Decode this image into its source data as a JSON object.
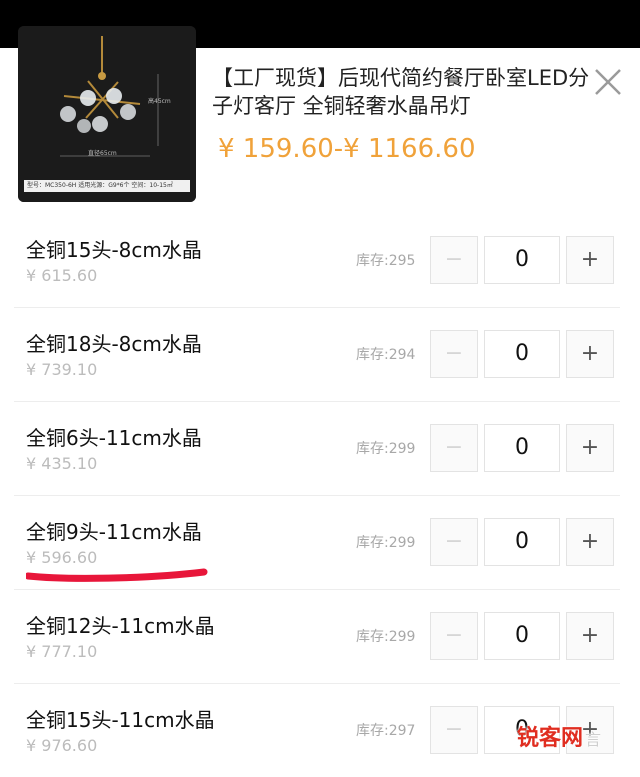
{
  "product": {
    "title": "【工厂现货】后现代简约餐厅卧室LED分子灯客厅 全铜轻奢水晶吊灯",
    "price_range": "¥ 159.60-¥ 1166.60",
    "image": {
      "height_label": "高45cm",
      "diameter_label": "直径65cm",
      "spec_strip": "型号：MC350-6H  适用光源：G9*6个  空间：10-15㎡"
    }
  },
  "variants": [
    {
      "name": "全铜15头-8cm水晶",
      "price": "¥ 615.60",
      "stock": "库存:295",
      "qty": "0"
    },
    {
      "name": "全铜18头-8cm水晶",
      "price": "¥ 739.10",
      "stock": "库存:294",
      "qty": "0"
    },
    {
      "name": "全铜6头-11cm水晶",
      "price": "¥ 435.10",
      "stock": "库存:299",
      "qty": "0"
    },
    {
      "name": "全铜9头-11cm水晶",
      "price": "¥ 596.60",
      "stock": "库存:299",
      "qty": "0"
    },
    {
      "name": "全铜12头-11cm水晶",
      "price": "¥ 777.10",
      "stock": "库存:299",
      "qty": "0"
    },
    {
      "name": "全铜15头-11cm水晶",
      "price": "¥ 976.60",
      "stock": "库存:297",
      "qty": "0"
    }
  ],
  "stepper": {
    "minus": "−",
    "plus": "+"
  },
  "watermark": {
    "text": "锐客网",
    "faint": "言"
  },
  "colors": {
    "price_accent": "#f0a23a",
    "underline": "#e8163a",
    "watermark": "#e02d20"
  },
  "icons": {
    "close": "close-icon"
  }
}
